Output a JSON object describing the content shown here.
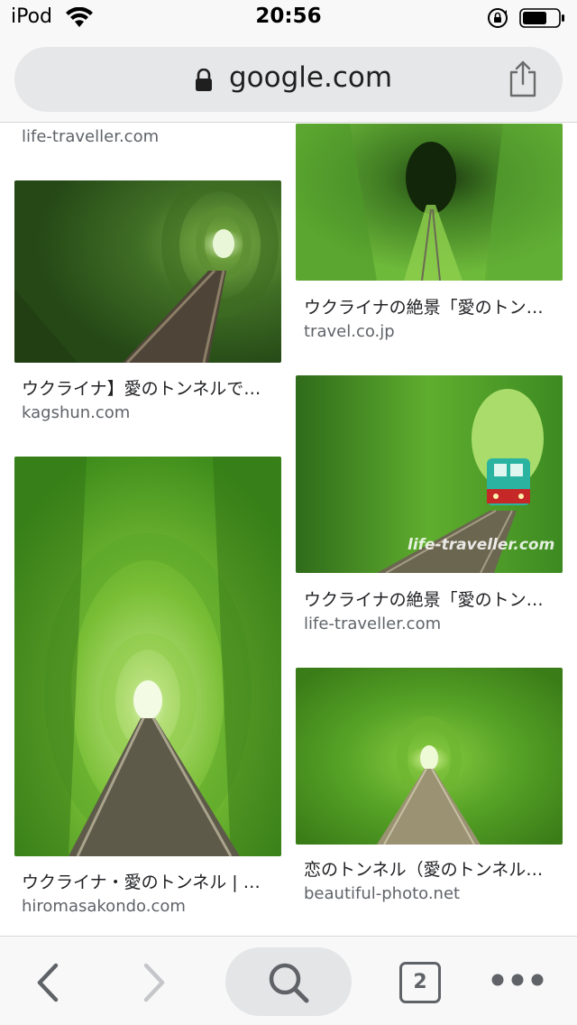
{
  "status_bar": {
    "carrier": "iPod",
    "time": "20:56"
  },
  "url_bar": {
    "domain": "google.com"
  },
  "results": {
    "top_left_source": "life-traveller.com",
    "items": [
      {
        "title": "ウクライナ】愛のトンネルで…",
        "source": "kagshun.com"
      },
      {
        "title": "ウクライナ・愛のトンネル | …",
        "source": "hiromasakondo.com"
      },
      {
        "title": "ウクライナの絶景「愛のトン…",
        "source": "travel.co.jp"
      },
      {
        "title": "ウクライナの絶景「愛のトン…",
        "source": "life-traveller.com",
        "watermark": "life-traveller.com"
      },
      {
        "title": "恋のトンネル（愛のトンネル…",
        "source": "beautiful-photo.net"
      }
    ]
  },
  "toolbar": {
    "tab_count": "2"
  },
  "colors": {
    "foliage_dark": "#2f5a1a",
    "foliage_light": "#7fc63a",
    "train_teal": "#2ab3a0",
    "train_red": "#c62828"
  }
}
